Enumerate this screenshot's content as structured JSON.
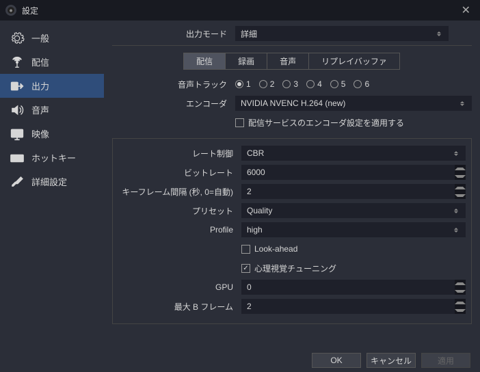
{
  "title": "設定",
  "sidebar": {
    "items": [
      {
        "label": "一般"
      },
      {
        "label": "配信"
      },
      {
        "label": "出力"
      },
      {
        "label": "音声"
      },
      {
        "label": "映像"
      },
      {
        "label": "ホットキー"
      },
      {
        "label": "詳細設定"
      }
    ]
  },
  "mode": {
    "label": "出力モード",
    "value": "詳細"
  },
  "tabs": {
    "stream": "配信",
    "record": "録画",
    "audio": "音声",
    "replay": "リプレイバッファ"
  },
  "track": {
    "label": "音声トラック",
    "opts": [
      "1",
      "2",
      "3",
      "4",
      "5",
      "6"
    ]
  },
  "encoder": {
    "label": "エンコーダ",
    "value": "NVIDIA NVENC H.264 (new)"
  },
  "enforce": {
    "label": "配信サービスのエンコーダ設定を適用する"
  },
  "rate": {
    "label": "レート制御",
    "value": "CBR"
  },
  "bitrate": {
    "label": "ビットレート",
    "value": "6000"
  },
  "keyframe": {
    "label": "キーフレーム間隔 (秒, 0=自動)",
    "value": "2"
  },
  "preset": {
    "label": "プリセット",
    "value": "Quality"
  },
  "profile": {
    "label": "Profile",
    "value": "high"
  },
  "lookahead": {
    "label": "Look-ahead"
  },
  "psycho": {
    "label": "心理視覚チューニング"
  },
  "gpu": {
    "label": "GPU",
    "value": "0"
  },
  "bframes": {
    "label": "最大 B フレーム",
    "value": "2"
  },
  "footer": {
    "ok": "OK",
    "cancel": "キャンセル",
    "apply": "適用"
  }
}
